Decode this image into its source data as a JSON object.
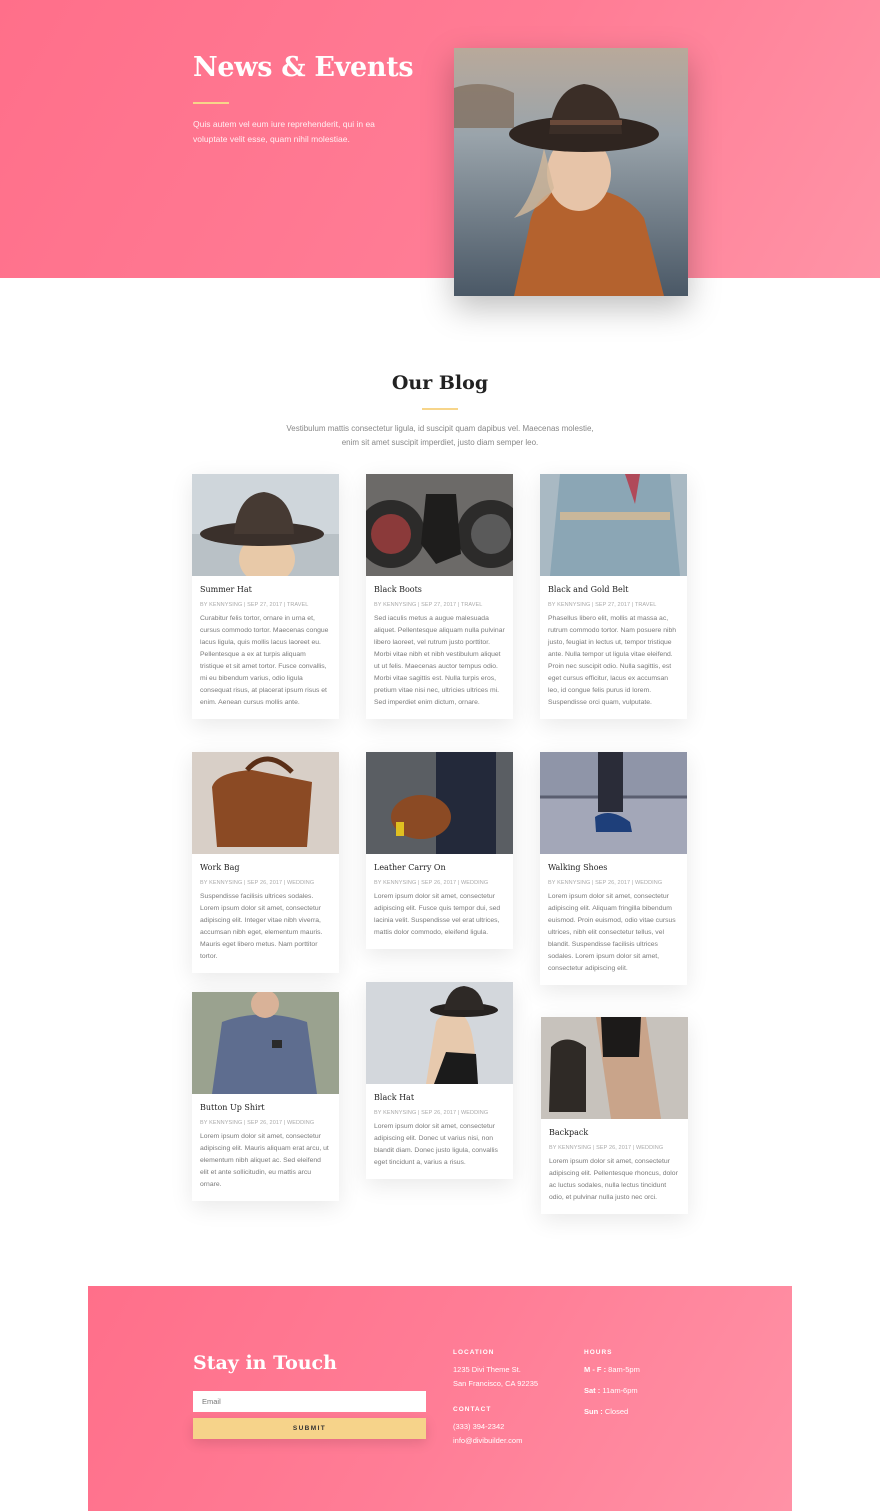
{
  "hero": {
    "title": "News & Events",
    "text": "Quis autem vel eum iure reprehenderit, qui in ea voluptate velit esse, quam nihil molestiae."
  },
  "blog": {
    "title": "Our Blog",
    "intro": "Vestibulum mattis consectetur ligula, id suscipit quam dapibus vel. Maecenas molestie, enim sit amet suscipit imperdiet, justo diam semper leo.",
    "posts": [
      {
        "title": "Summer Hat",
        "meta": "BY KENNYSING | SEP 27, 2017 | TRAVEL",
        "excerpt": "Curabitur felis tortor, ornare in urna et, cursus commodo tortor. Maecenas congue lacus ligula, quis mollis lacus laoreet eu. Pellentesque a ex at turpis aliquam tristique et sit amet tortor. Fusce convallis, mi eu bibendum varius, odio ligula consequat risus, at placerat ipsum risus et enim. Aenean cursus mollis ante."
      },
      {
        "title": "Black Boots",
        "meta": "BY KENNYSING | SEP 27, 2017 | TRAVEL",
        "excerpt": "Sed iaculis metus a augue malesuada aliquet. Pellentesque aliquam nulla pulvinar libero laoreet, vel rutrum justo porttitor. Morbi vitae nibh et nibh vestibulum aliquet ut ut felis. Maecenas auctor tempus odio. Morbi vitae sagittis est. Nulla turpis eros, pretium vitae nisi nec, ultricies ultrices mi. Sed imperdiet enim dictum, ornare."
      },
      {
        "title": "Black and Gold Belt",
        "meta": "BY KENNYSING | SEP 27, 2017 | TRAVEL",
        "excerpt": "Phasellus libero elit, mollis at massa ac, rutrum commodo tortor. Nam posuere nibh justo, feugiat in lectus ut, tempor tristique ante. Nulla tempor ut ligula vitae eleifend. Proin nec suscipit odio. Nulla sagittis, est eget cursus efficitur, lacus ex accumsan leo, id congue felis purus id lorem. Suspendisse orci quam, vulputate."
      },
      {
        "title": "Work Bag",
        "meta": "BY KENNYSING | SEP 26, 2017 | WEDDING",
        "excerpt": "Suspendisse facilisis ultrices sodales. Lorem ipsum dolor sit amet, consectetur adipiscing elit. Integer vitae nibh viverra, accumsan nibh eget, elementum mauris. Mauris eget libero metus. Nam porttitor tortor."
      },
      {
        "title": "Leather Carry On",
        "meta": "BY KENNYSING | SEP 26, 2017 | WEDDING",
        "excerpt": "Lorem ipsum dolor sit amet, consectetur adipiscing elit. Fusce quis tempor dui, sed lacinia velit. Suspendisse vel erat ultrices, mattis dolor commodo, eleifend ligula."
      },
      {
        "title": "Walking Shoes",
        "meta": "BY KENNYSING | SEP 26, 2017 | WEDDING",
        "excerpt": "Lorem ipsum dolor sit amet, consectetur adipiscing elit. Aliquam fringilla bibendum euismod. Proin euismod, odio vitae cursus ultrices, nibh elit consectetur tellus, vel blandit. Suspendisse facilisis ultrices sodales. Lorem ipsum dolor sit amet, consectetur adipiscing elit."
      },
      {
        "title": "Button Up Shirt",
        "meta": "BY KENNYSING | SEP 26, 2017 | WEDDING",
        "excerpt": "Lorem ipsum dolor sit amet, consectetur adipiscing elit. Mauris aliquam erat arcu, ut elementum nibh aliquet ac. Sed eleifend elit et ante sollicitudin, eu mattis arcu ornare."
      },
      {
        "title": "Black Hat",
        "meta": "BY KENNYSING | SEP 26, 2017 | WEDDING",
        "excerpt": "Lorem ipsum dolor sit amet, consectetur adipiscing elit. Donec ut varius nisi, non blandit diam. Donec justo ligula, convallis eget tincidunt a, varius a risus."
      },
      {
        "title": "Backpack",
        "meta": "BY KENNYSING | SEP 26, 2017 | WEDDING",
        "excerpt": "Lorem ipsum dolor sit amet, consectetur adipiscing elit. Pellentesque rhoncus, dolor ac luctus sodales, nulla lectus tincidunt odio, et pulvinar nulla justo nec orci."
      }
    ]
  },
  "footer": {
    "title": "Stay in Touch",
    "email_placeholder": "Email",
    "submit_label": "SUBMIT",
    "location_heading": "LOCATION",
    "address_1": "1235 Divi Theme St.",
    "address_2": "San Francisco, CA 92235",
    "contact_heading": "CONTACT",
    "phone": "(333) 394-2342",
    "email": "info@divibuilder.com",
    "hours_heading": "HOURS",
    "hours": [
      {
        "day": "M - F :",
        "time": "8am-5pm"
      },
      {
        "day": "Sat :",
        "time": "11am-6pm"
      },
      {
        "day": "Sun :",
        "time": "Closed"
      }
    ]
  },
  "colors": {
    "brand_pink": "#ff7c95",
    "accent_gold": "#f6d38a",
    "heading_dark": "#222222"
  }
}
